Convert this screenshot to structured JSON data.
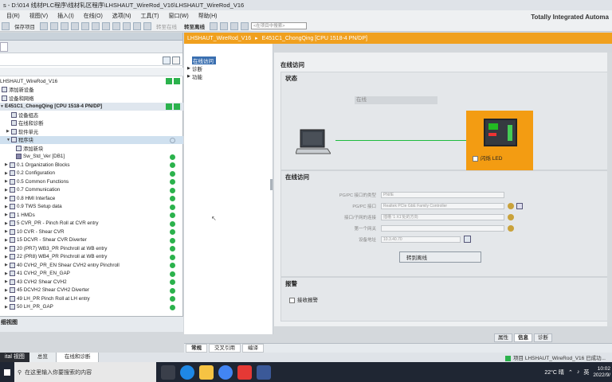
{
  "window": {
    "title": "s - D:\\014 线材PLC程序\\线材轧区程序\\LHSHAUT_WireRod_V16\\LHSHAUT_WireRod_V16"
  },
  "menu": [
    "目(R)",
    "视图(V)",
    "插入(I)",
    "在线(O)",
    "选项(N)",
    "工具(T)",
    "窗口(W)",
    "帮助(H)"
  ],
  "toolbar": {
    "save_label": "保存项目",
    "online_label": "转至在线",
    "offline_label": "转至离线",
    "search_placeholder": "<在项目中搜索>"
  },
  "brand": {
    "name": "Totally Integrated Automa",
    "sub": "PO"
  },
  "breadcrumb": {
    "project": "LHSHAUT_WireRod_V16",
    "separator": "▸",
    "device": "E451C1_ChongQing [CPU 1518-4 PN/DP]"
  },
  "project_tree": {
    "rows": [
      {
        "label": "LHSHAUT_WireRod_V16",
        "indent": 0
      },
      {
        "label": "添加新设备",
        "indent": 1
      },
      {
        "label": "设备和网络",
        "indent": 1
      },
      {
        "label": "E451C1_ChongQing [CPU 1518-4 PN/DP]",
        "indent": 1
      },
      {
        "label": "设备组态",
        "indent": 2
      },
      {
        "label": "在线和诊断",
        "indent": 2
      },
      {
        "label": "软件单元",
        "indent": 2
      },
      {
        "label": "程序块",
        "indent": 2
      },
      {
        "label": "添加新块",
        "indent": 3
      },
      {
        "label": "Sw_Std_Ver [DB1]",
        "indent": 3
      },
      {
        "label": "0.1 Organization Blocks",
        "indent": 3
      },
      {
        "label": "0.2 Configuration",
        "indent": 3
      },
      {
        "label": "0.5 Common Functions",
        "indent": 3
      },
      {
        "label": "0.7 Communication",
        "indent": 3
      },
      {
        "label": "0.8 HMI Interface",
        "indent": 3
      },
      {
        "label": "0.9 TWS Setup data",
        "indent": 3
      },
      {
        "label": "1 HMDs",
        "indent": 3
      },
      {
        "label": "5 CVR_PR - Pinch Roll at CVR entry",
        "indent": 3
      },
      {
        "label": "10 CVR - Shear CVR",
        "indent": 3
      },
      {
        "label": "15 DCVR - Shear CVR Diverter",
        "indent": 3
      },
      {
        "label": "20 (PR7) WB3_PR Pinchroll at WB entry",
        "indent": 3
      },
      {
        "label": "22 (PR8) WB4_PR Pinchroll at WB entry",
        "indent": 3
      },
      {
        "label": "40 CVH2_PR_EN Shear CVH2 entry Pinchroll",
        "indent": 3
      },
      {
        "label": "41 CVH2_PR_EN_GAP",
        "indent": 3
      },
      {
        "label": "43 CVH2 Shear CVH2",
        "indent": 3
      },
      {
        "label": "45 DCVH2 Shear CVH2 Diverter",
        "indent": 3
      },
      {
        "label": "49 LH_PR Pinch Roll at LH entry",
        "indent": 3
      },
      {
        "label": "50 LH_PR_GAP",
        "indent": 3
      }
    ]
  },
  "details_view": {
    "label": "细视图"
  },
  "nav": {
    "items": [
      "在线访问",
      "诊断",
      "功能"
    ]
  },
  "online_access": {
    "title": "在线访问",
    "status_section": "状态",
    "status_text": "在线",
    "flash_led": "闪烁 LED",
    "online_section": "在线访问",
    "fields": [
      {
        "label": "PG/PC 接口的类型",
        "value": "PN/IE"
      },
      {
        "label": "PG/PC 接口",
        "value": "Realtek PCIe GbE Family Controller"
      },
      {
        "label": "接口/子网的连接",
        "value": "插槽 '1 X1'处的方向"
      },
      {
        "label": "第一个网关",
        "value": ""
      },
      {
        "label": "设备地址",
        "value": "10.3.40.70"
      }
    ],
    "go_offline_button": "转到离线",
    "alarm_section": "报警",
    "receive_alarms": "接收报警"
  },
  "bottom_tabs": [
    "属性",
    "信息",
    "诊断"
  ],
  "info_strip": [
    "常规",
    "交叉引用",
    "编译"
  ],
  "portal": {
    "left": "ital 视图",
    "tabs": [
      "总览",
      "在线和诊断"
    ],
    "status": "项目 LHSHAUT_WireRod_V16 已成功..."
  },
  "taskbar": {
    "search": "在这里输入你要搜索的内容",
    "weather": "22°C 晴",
    "lang": "英",
    "time": "10:02",
    "date": "2022/9/"
  }
}
